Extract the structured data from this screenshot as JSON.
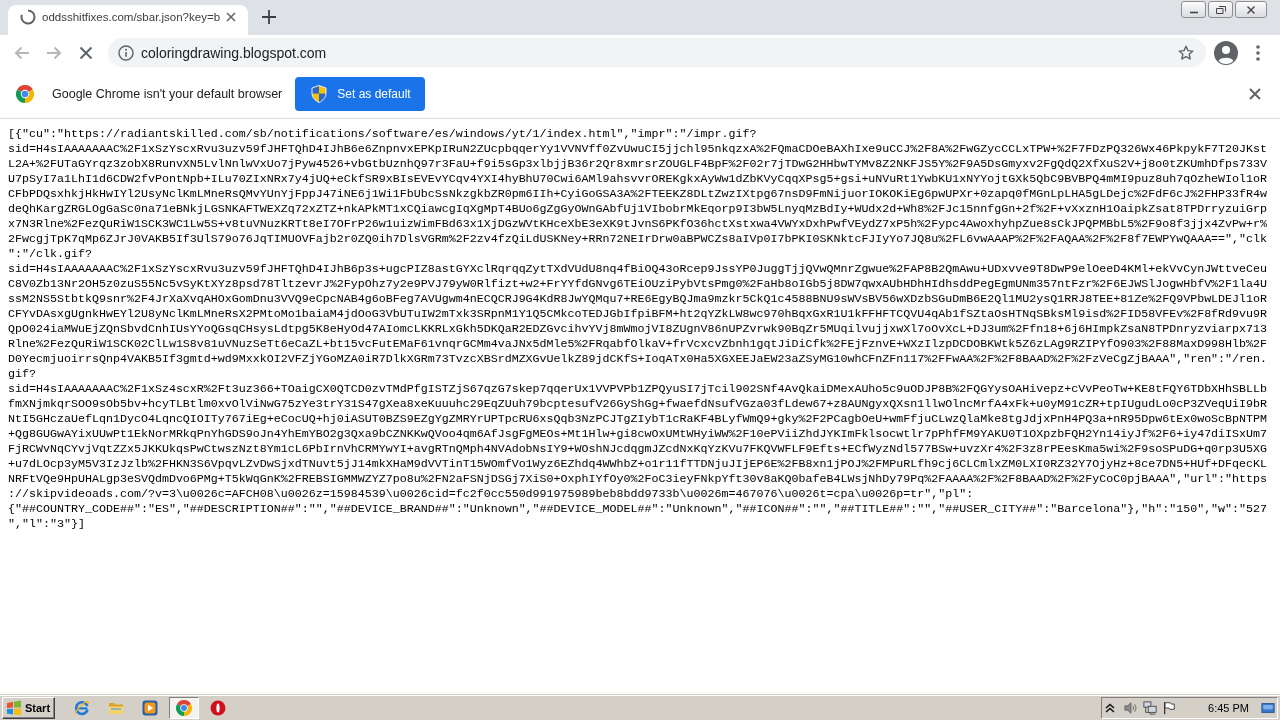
{
  "tab_strip": {
    "tabs": [
      {
        "title": "oddsshitfixes.com/sbar.json?key=b",
        "selected": true,
        "loading": true
      }
    ]
  },
  "toolbar": {
    "nav_buttons": [
      {
        "kind": "back",
        "disabled": true
      },
      {
        "kind": "forward",
        "disabled": true
      },
      {
        "kind": "stop",
        "disabled": false
      }
    ],
    "address": "coloringdrawing.blogspot.com"
  },
  "infobar": {
    "message": "Google Chrome isn't your default browser",
    "button": "Set as default"
  },
  "page": {
    "lines": [
      "[{\"cu\":\"https://radiantskilled.com/sb/notifications/software/es/windows/yt/1/index.html\",\"impr\":\"/impr.gif?",
      "sid=H4sIAAAAAAAC%2F1xSzYscxRvu3uzv59fJHFTQhD4IJhB6e6ZnpnvxEPKpIRuN2ZUcpbqqerYy1VVNVff0ZvUwuCI5jjchl95nkqzxA%2FQmaCDOeBAXhIxe9uCCJ%2F8A%2FwGZycCCLxTPW+%2F7FDzPQ326Wx46PkpykF7T20JKst",
      "L2A+%2FUTaGYrqz3zobX8RunvXN5LvlNnlwVxUo7jPyw4526+vbGtbUznhQ97r3FaU+f9i5sGp3xlbjjB36r2Qr8xmrsrZOUGLF4BpF%2F02r7jTDwG2HHbwTYMv8Z2NKFJS5Y%2F9A5DsGmyxv2FgQdQ2XfXuS2V+j8o0tZKUmhDfps733V",
      "U7pSyI7a1LhI1d6CDW2fvPontNpb+ILu70ZIxNRx7y4jUQ+eCkfSR9xBIsEVEvYCqv4YXI4hyBhU70Cwi6AMl9ahsvvrOREKgkxAyWw1dZbKVyCqqXPsg5+gsi+uNVuRt1YwbKU1xNYYojtGXk5QbC9BVBPQ4mMI9puz8uh7qOzheWIol1oR",
      "CFbPDQsxhkjHkHwIYl2UsyNclKmLMneRsQMvYUnYjFppJ47iNE6j1Wi1FbUbcSsNkzgkbZR0pm6IIh+CyiGoGSA3A%2FTEEKZ8DLtZwzIXtpg67nsD9FmNijuorIOKOKiEg6pwUPXr+0zapq0fMGnLpLHA5gLDejc%2FdF6cJ%2FHP33fR4w",
      "deQhKargZRGLOgGaSc0na71eBNkjLGSNKAFTWEXZq72xZTZ+nkAPkMT1xCQiawcgIqXgMpT4BUo6gZgGyOWnGAbfUj1VIbobrMkEqorp9I3bW5LnyqMzBdIy+WUdx2d+Wh8%2FJc15nnfgGn+2f%2F+vXxznH1OaipkZsat8TPDrryzuiGrp",
      "x7N3Rlne%2FezQuRiW1SCK3WC1Lw5S+v8tuVNuzKRTt8eI7OFrP26w1uizWimFBd63x1XjDGzWVtKHceXbE3eXK9tJvnS6PKfO36hctXstxwa4VWYxDxhPwfVEydZ7xP5h%2Fypc4AwoxhyhpZue8sCkJPQPMBbL5%2F9o8f3jjx4ZvPw+r%",
      "2FwcgjTpK7qMp6ZJrJ0VAKB5If3UlS79o76JqTIMUOVFajb2r0ZQ0ih7DlsVGRm%2F2zv4fzQiLdUSKNey+RRn72NEIrDrw0aBPWCZs8aIVp0I7bPKI0SKNktcFJIyYo7JQ8u%2FL6vwAAAP%2F%2FAQAA%2F%2F8f7EWPYwQAAA==\",\"clk",
      "\":\"/clk.gif?",
      "sid=H4sIAAAAAAAC%2F1xSzYscxRvu3uzv59fJHFTQhD4IJhB6p3s+ugcPIZ8astGYXclRqrqqZytTXdVUdU8nq4fBiOQ43oRcep9JssYP0JuggTjjQVwQMnrZgwue%2FAP8B2QmAwu+UDxvve9T8DwP9elOeeD4KMl+ekVvCynJWttveCeu",
      "C8V0Zb13Nr2OH5z0zuS55Nc5vSyKtXYz8psd78TltzevrJ%2FypOhz7y2e9PVJ79yW0Rlfizt+w2+FrYYfdGNvg6TEiOUziPybVtsPmg0%2FaHb8oIGb5j8DW7qwxAUbHDhHIdhsddPegEgmUNm357ntFzr%2F6EJWSlJogwHbfV%2F1la4U",
      "ssM2NS5StbtkQ9snr%2F4JrXaXvqAHOxGomDnu3VVQ9eCpcNAB4g6oBFeg7AVUgwm4nECQCRJ9G4KdR8JwYQMqu7+RE6EgyBQJma9mzkr5CkQ1c4588BNU9sWVsBV56wXDzbSGuDmB6E2Ql1MU2ysQ1RRJ8TEE+81Ze%2FQ9VPbwLDEJl1oR",
      "CFYvDAsxgUgnkHwEYl2U8yNclKmLMneRsX2PMtoMo1baiaM4jdOoG3VbUTuIW2mTxk3SRpnM1Y1Q5CMkcoTEDJGbIfpiBFM+ht2qYZkLW8wc970hBqxGxR1U1kFFHFTCQVU4qAb1fSZtaOsHTNqSBksMl9isd%2FID58VFEv%2F8fRd9vu9R",
      "QpO024iaMWuEjZQnSbvdCnhIUsYYoQGsqCHsysLdtpg5K8eHyOd47AIomcLKKRLxGkh5DKQaR2EDZGvcihvYVj8mWmojVI8ZUgnV86nUPZvrwk90BqZr5MUqilvujjxwXl7oOvXcL+DJ3um%2Ffn18+6j6HImpkZsaN8TPDnryzviarpx713",
      "Rlne%2FezQuRiW1SCK02ClLw1S8v81uVNuzSeTt6eCaZL+bt15vcFutEMaF61vnqrGCMm4vaJNx5dMle5%2FRqabfOlkaV+frVcxcvZbnh1gqtJiDiCfk%2FEjFznvE+WXzIlzpDCDOBKWtk5Z6zLAg9RZIPYfO903%2F88MaxD998Hlb%2F",
      "D0YecmjuoirrsQnp4VAKB5If3gmtd+wd9MxxkOI2VFZjYGoMZA0iR7DlkXGRm73TvzcXBSrdMZXGvUelkZ89jdCKfS+IoqATx0Ha5XGXEEJaEW23aZSyMG10whCFnZFn117%2FFwAA%2F%2F8BAAD%2F%2FzVeCgZjBAAA\",\"ren\":\"/ren.",
      "gif?",
      "sid=H4sIAAAAAAAC%2F1xSz4scxR%2Ft3uz366+TOaigCX0QTCD0zvTMdPfgISTZjS67qzG7skep7qqerUx1VVPVPb1ZPQyuSI7jTcil902SNf4AvQkaiDMexAUho5c9uODJP8B%2FQGYysOAHivepz+cVvPeoTw+KE8tFQY6TDbXHhSBLLb",
      "fmXNjmkqrSOO9sOb5bv+hcyTLBtlm0xvOlViNwG75zYe3trY31S47gXea8xeKuuuhc29EqZUuh79bcptesufV26GyShGg+fwaefdNsufVGza03fLdew67+z8AUNgyxQXsn1llwOlncMrfA4xFk+u0yM91cZR+tpIUgudLo0cP3ZVeqUiI9bR",
      "NtI5GHczaUefLqn1DycO4LqncQIOITy767iEg+eCocUQ+hj0iASUT0BZS9EZgYgZMRYrUPTpcRU6xsQqb3NzPCJTgZIybT1cRaKF4BLyfWmQ9+gky%2F2PCagbOeU+wmFfjuCLwzQlaMke8tgJdjxPnH4PQ3a+nR95Dpw6tEx0woScBpNTPM",
      "+Qg8GUGwAYixUUwPt1EkNorMRkqPnYhGDS9oJn4YhEmYBO2g3Qxa9bCZNKKwQVoo4qm6AfJsgFgMEOs+Mt1Hlw+gi8cwOxUMtWHyiWW%2F10ePViiZhdJYKImFklsocwtlr7pPhfFM9YAKU0T1OXpzbFQH2Yn14iyJf%2F6+iy47diISxUm7",
      "FjRCWvNqCYvjVqtZZx5JKKUkqsPwCtwszNzt8Ym1cL6PbIrnVhCRMYwYI+avgRTnQMph4NVAdobNsIY9+WOshNJcdqgmJZcdNxKqYzKVu7FKQVWFLF9Efts+ECfWyzNdl577BSw+uvzXr4%2F3z8rPEesKma5wi%2F9soSPuDG+q0rp3U5XG",
      "+u7dLOcp3yM5V3IzJzlb%2FHKN3S6VpqvLZvDwSjxdTNuvt5jJ14mkXHaM9dVVTinT15WOmfVo1Wyz6EZhdq4WWhbZ+o1r11fTTDNjuJIjEP6E%2FB8xn1jPOJ%2FMPuRLfh9cj6CLCmlxZM0LXI0RZ32Y7OjyHz+8ce7DN5+HUf+DFqecKL",
      "NRFtVQe9HpUHALgp3eSVQdmDvo6PMg+T5kWqGnK%2FREBSIGMMWZYZ7po8u%2FN2aFSNjDSGj7XiS0+OxphIYfOy0%2FoC3ieyFNkpYft30v8aKQ0bafeB4LWsjNhDy79Pq%2FAAAA%2F%2F8BAAD%2F%2FyCoC0pjBAAA\",\"url\":\"https",
      "://skipvideoads.com/?v=3\\u0026c=AFCH08\\u0026z=15984539\\u0026cid=fc2f0cc550d991975989beb8bdd9733b\\u0026m=467076\\u0026t=cpa\\u0026p=tr\",\"pl\":",
      "{\"##COUNTRY_CODE##\":\"ES\",\"##DESCRIPTION##\":\"\",\"##DEVICE_BRAND##\":\"Unknown\",\"##DEVICE_MODEL##\":\"Unknown\",\"##ICON##\":\"\",\"##TITLE##\":\"\",\"##USER_CITY##\":\"Barcelona\"},\"h\":\"150\",\"w\":\"527",
      "\",\"l\":\"3\"}]"
    ]
  },
  "taskbar": {
    "start": "Start",
    "apps": [
      {
        "kind": "ie",
        "active": false
      },
      {
        "kind": "folder",
        "active": false
      },
      {
        "kind": "player",
        "active": false
      },
      {
        "kind": "chrome",
        "active": true
      },
      {
        "kind": "ring",
        "active": false
      }
    ],
    "clock": "6:45 PM"
  }
}
